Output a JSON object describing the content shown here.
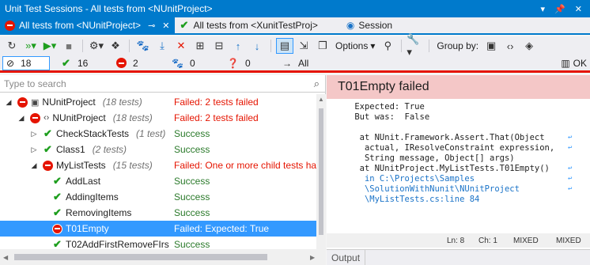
{
  "title": "Unit Test Sessions - All tests from <NUnitProject>",
  "tabs": [
    {
      "label": "All tests from <NUnitProject>",
      "status": "failed"
    },
    {
      "label": "All tests from <XunitTestProj>",
      "status": "passed"
    },
    {
      "label": "Session",
      "status": "info"
    }
  ],
  "toolbar": {
    "options_label": "Options",
    "group_by_label": "Group by:"
  },
  "counts": {
    "total": "18",
    "passed": "16",
    "failed": "2",
    "ignored": "0",
    "unknown": "0",
    "all_label": "All",
    "ok_label": "OK"
  },
  "search": {
    "placeholder": "Type to search"
  },
  "tree": [
    {
      "label": "NUnitProject",
      "count": "(18 tests)",
      "status": "Failed: 2 tests failed",
      "kind": "fail"
    },
    {
      "label": "NUnitProject",
      "count": "(18 tests)",
      "status": "Failed: 2 tests failed",
      "kind": "fail"
    },
    {
      "label": "CheckStackTests",
      "count": "(1 test)",
      "status": "Success",
      "kind": "ok"
    },
    {
      "label": "Class1",
      "count": "(2 tests)",
      "status": "Success",
      "kind": "ok"
    },
    {
      "label": "MyListTests",
      "count": "(15 tests)",
      "status": "Failed: One or more child tests ha",
      "kind": "fail"
    },
    {
      "label": "AddLast",
      "count": "",
      "status": "Success",
      "kind": "ok"
    },
    {
      "label": "AddingItems",
      "count": "",
      "status": "Success",
      "kind": "ok"
    },
    {
      "label": "RemovingItems",
      "count": "",
      "status": "Success",
      "kind": "ok"
    },
    {
      "label": "T01Empty",
      "count": "",
      "status": "Failed:   Expected: True",
      "kind": "fail"
    },
    {
      "label": "T02AddFirstRemoveFIrs",
      "count": "",
      "status": "Success",
      "kind": "ok"
    }
  ],
  "detail": {
    "title": "T01Empty failed",
    "lines": [
      " Expected: True",
      " But was:  False",
      "",
      "  at NUnit.Framework.Assert.That(Object",
      "   actual, IResolveConstraint expression,",
      "   String message, Object[] args)",
      "  at NUnitProject.MyListTests.T01Empty()",
      "   in C:\\Projects\\Samples",
      "   \\SolutionWithNunit\\NUnitProject",
      "   \\MyListTests.cs:line 84"
    ],
    "status": {
      "line": "Ln: 8",
      "col": "Ch: 1",
      "mixed1": "MIXED",
      "mixed2": "MIXED"
    },
    "output_tab": "Output"
  },
  "colors": {
    "accent": "#007acc",
    "fail": "#e51400",
    "pass": "#1e9e1e",
    "header_fail": "#f4c7c7"
  }
}
